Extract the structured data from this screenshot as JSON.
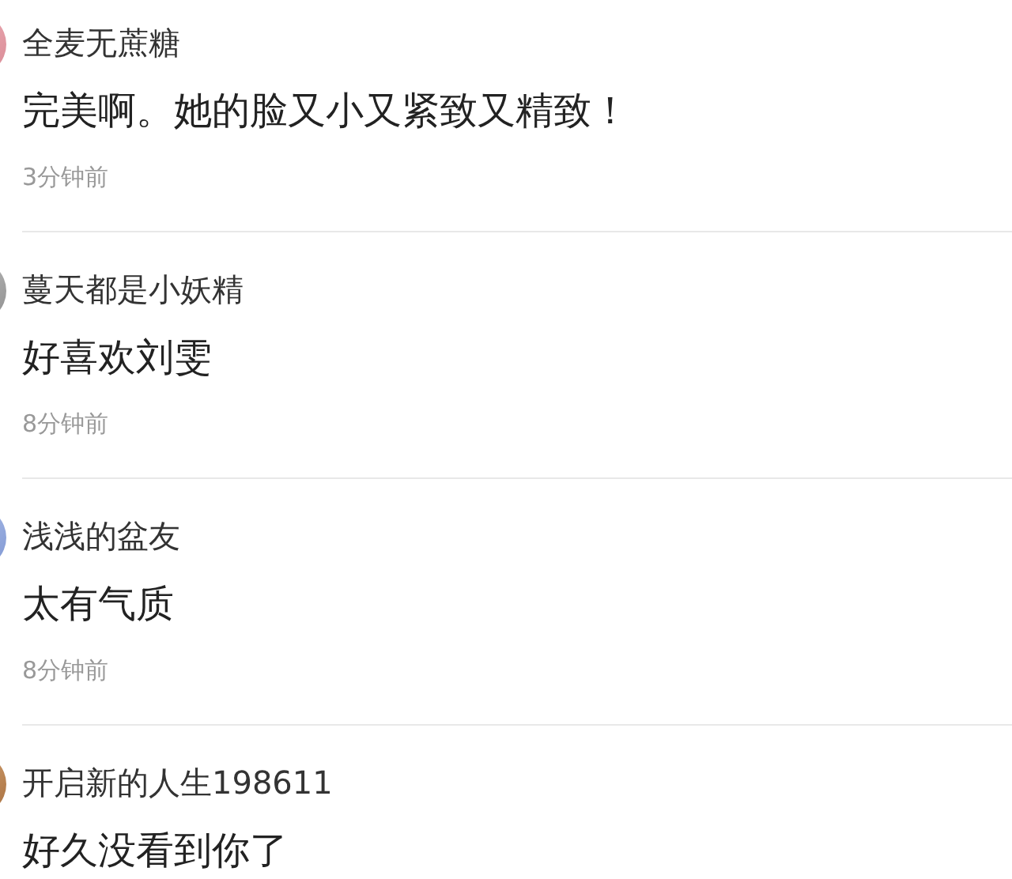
{
  "comments": [
    {
      "user": "全麦无蔗糖",
      "text": "完美啊。她的脸又小又紧致又精致！",
      "time": "3分钟前"
    },
    {
      "user": "蔓天都是小妖精",
      "text": "好喜欢刘雯",
      "time": "8分钟前"
    },
    {
      "user": "浅浅的盆友",
      "text": "太有气质",
      "time": "8分钟前"
    },
    {
      "user": "开启新的人生198611",
      "text": "好久没看到你了"
    }
  ]
}
